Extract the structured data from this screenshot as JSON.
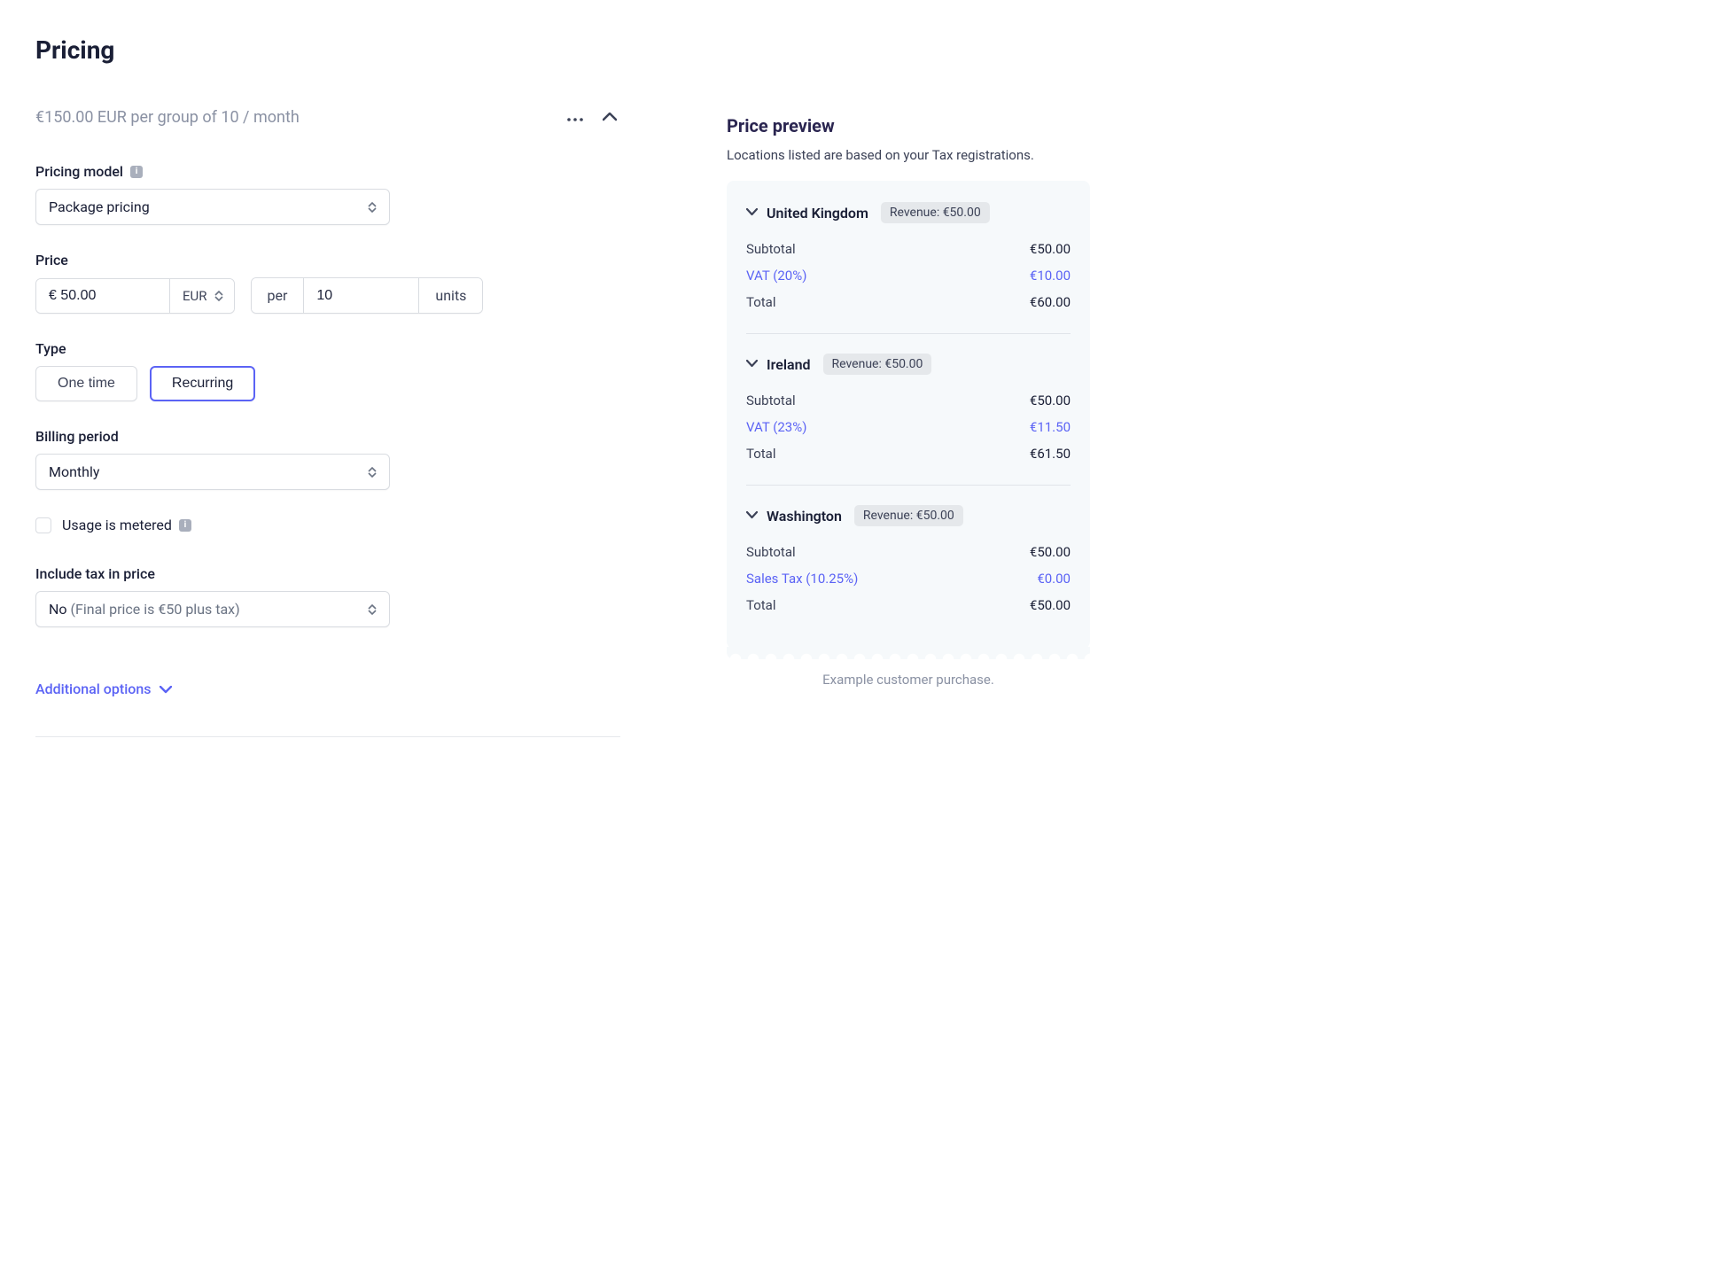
{
  "page_title": "Pricing",
  "summary": "€150.00 EUR per group of 10 / month",
  "labels": {
    "pricing_model": "Pricing model",
    "price": "Price",
    "type": "Type",
    "billing_period": "Billing period",
    "usage_metered": "Usage is metered",
    "include_tax": "Include tax in price",
    "additional_options": "Additional options"
  },
  "pricing_model_value": "Package pricing",
  "price_value": "€ 50.00",
  "currency": "EUR",
  "per_label": "per",
  "per_qty": "10",
  "per_unit": "units",
  "type_options": {
    "one_time": "One time",
    "recurring": "Recurring"
  },
  "type_selected": "recurring",
  "billing_period_value": "Monthly",
  "include_tax_value_prefix": "No ",
  "include_tax_value_rest": "(Final price is €50 plus tax)",
  "preview": {
    "title": "Price preview",
    "subtitle": "Locations listed are based on your Tax registrations.",
    "example_note": "Example customer purchase.",
    "locations": [
      {
        "name": "United Kingdom",
        "revenue": "Revenue: €50.00",
        "rows": [
          {
            "label": "Subtotal",
            "value": "€50.00",
            "tax": false
          },
          {
            "label": "VAT (20%)",
            "value": "€10.00",
            "tax": true
          },
          {
            "label": "Total",
            "value": "€60.00",
            "tax": false
          }
        ]
      },
      {
        "name": "Ireland",
        "revenue": "Revenue: €50.00",
        "rows": [
          {
            "label": "Subtotal",
            "value": "€50.00",
            "tax": false
          },
          {
            "label": "VAT (23%)",
            "value": "€11.50",
            "tax": true
          },
          {
            "label": "Total",
            "value": "€61.50",
            "tax": false
          }
        ]
      },
      {
        "name": "Washington",
        "revenue": "Revenue: €50.00",
        "rows": [
          {
            "label": "Subtotal",
            "value": "€50.00",
            "tax": false
          },
          {
            "label": "Sales Tax (10.25%)",
            "value": "€0.00",
            "tax": true
          },
          {
            "label": "Total",
            "value": "€50.00",
            "tax": false
          }
        ]
      }
    ]
  }
}
